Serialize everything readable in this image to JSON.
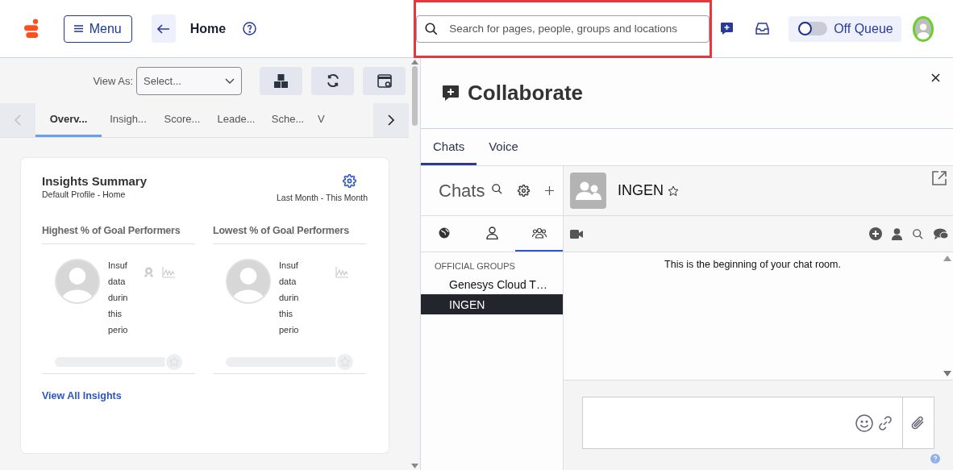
{
  "top_bar": {
    "menu_label": "Menu",
    "page_title": "Home",
    "search": {
      "placeholder": "Search for pages, people, groups and locations",
      "highlighted": true
    },
    "queue": {
      "label": "Off Queue",
      "on": false
    }
  },
  "toolbar": {
    "view_as_label": "View As:",
    "view_as": {
      "placeholder": "Select..."
    }
  },
  "tabs": [
    {
      "label": "Overv...",
      "selected": true
    },
    {
      "label": "Insigh...",
      "selected": false
    },
    {
      "label": "Score...",
      "selected": false
    },
    {
      "label": "Leade...",
      "selected": false
    },
    {
      "label": "Sche...",
      "selected": false
    },
    {
      "label": "V",
      "selected": false
    }
  ],
  "insights_card": {
    "title": "Insights Summary",
    "subtitle": "Default Profile - Home",
    "period": "Last Month - This Month",
    "columns": [
      {
        "title": "Highest % of Goal Performers",
        "lines": [
          "Insuf",
          "data",
          "durin",
          "this",
          "perio"
        ],
        "award": true
      },
      {
        "title": "Lowest % of Goal Performers",
        "lines": [
          "Insuf",
          "data",
          "durin",
          "this",
          "perio"
        ],
        "award": false
      }
    ],
    "link": "View All Insights"
  },
  "collaborate": {
    "title": "Collaborate",
    "tabs": [
      {
        "label": "Chats",
        "selected": true
      },
      {
        "label": "Voice",
        "selected": false
      }
    ],
    "chats_heading": "Chats",
    "filters": [
      {
        "kind": "globe",
        "selected": false
      },
      {
        "kind": "person",
        "selected": false
      },
      {
        "kind": "group",
        "selected": true
      }
    ],
    "group_heading": "OFFICIAL GROUPS",
    "groups": [
      {
        "name": "Genesys Cloud T…",
        "selected": false
      },
      {
        "name": "INGEN",
        "selected": true
      }
    ],
    "room": {
      "name": "INGEN",
      "starred": false,
      "intro": "This is the beginning of your chat room."
    }
  }
}
